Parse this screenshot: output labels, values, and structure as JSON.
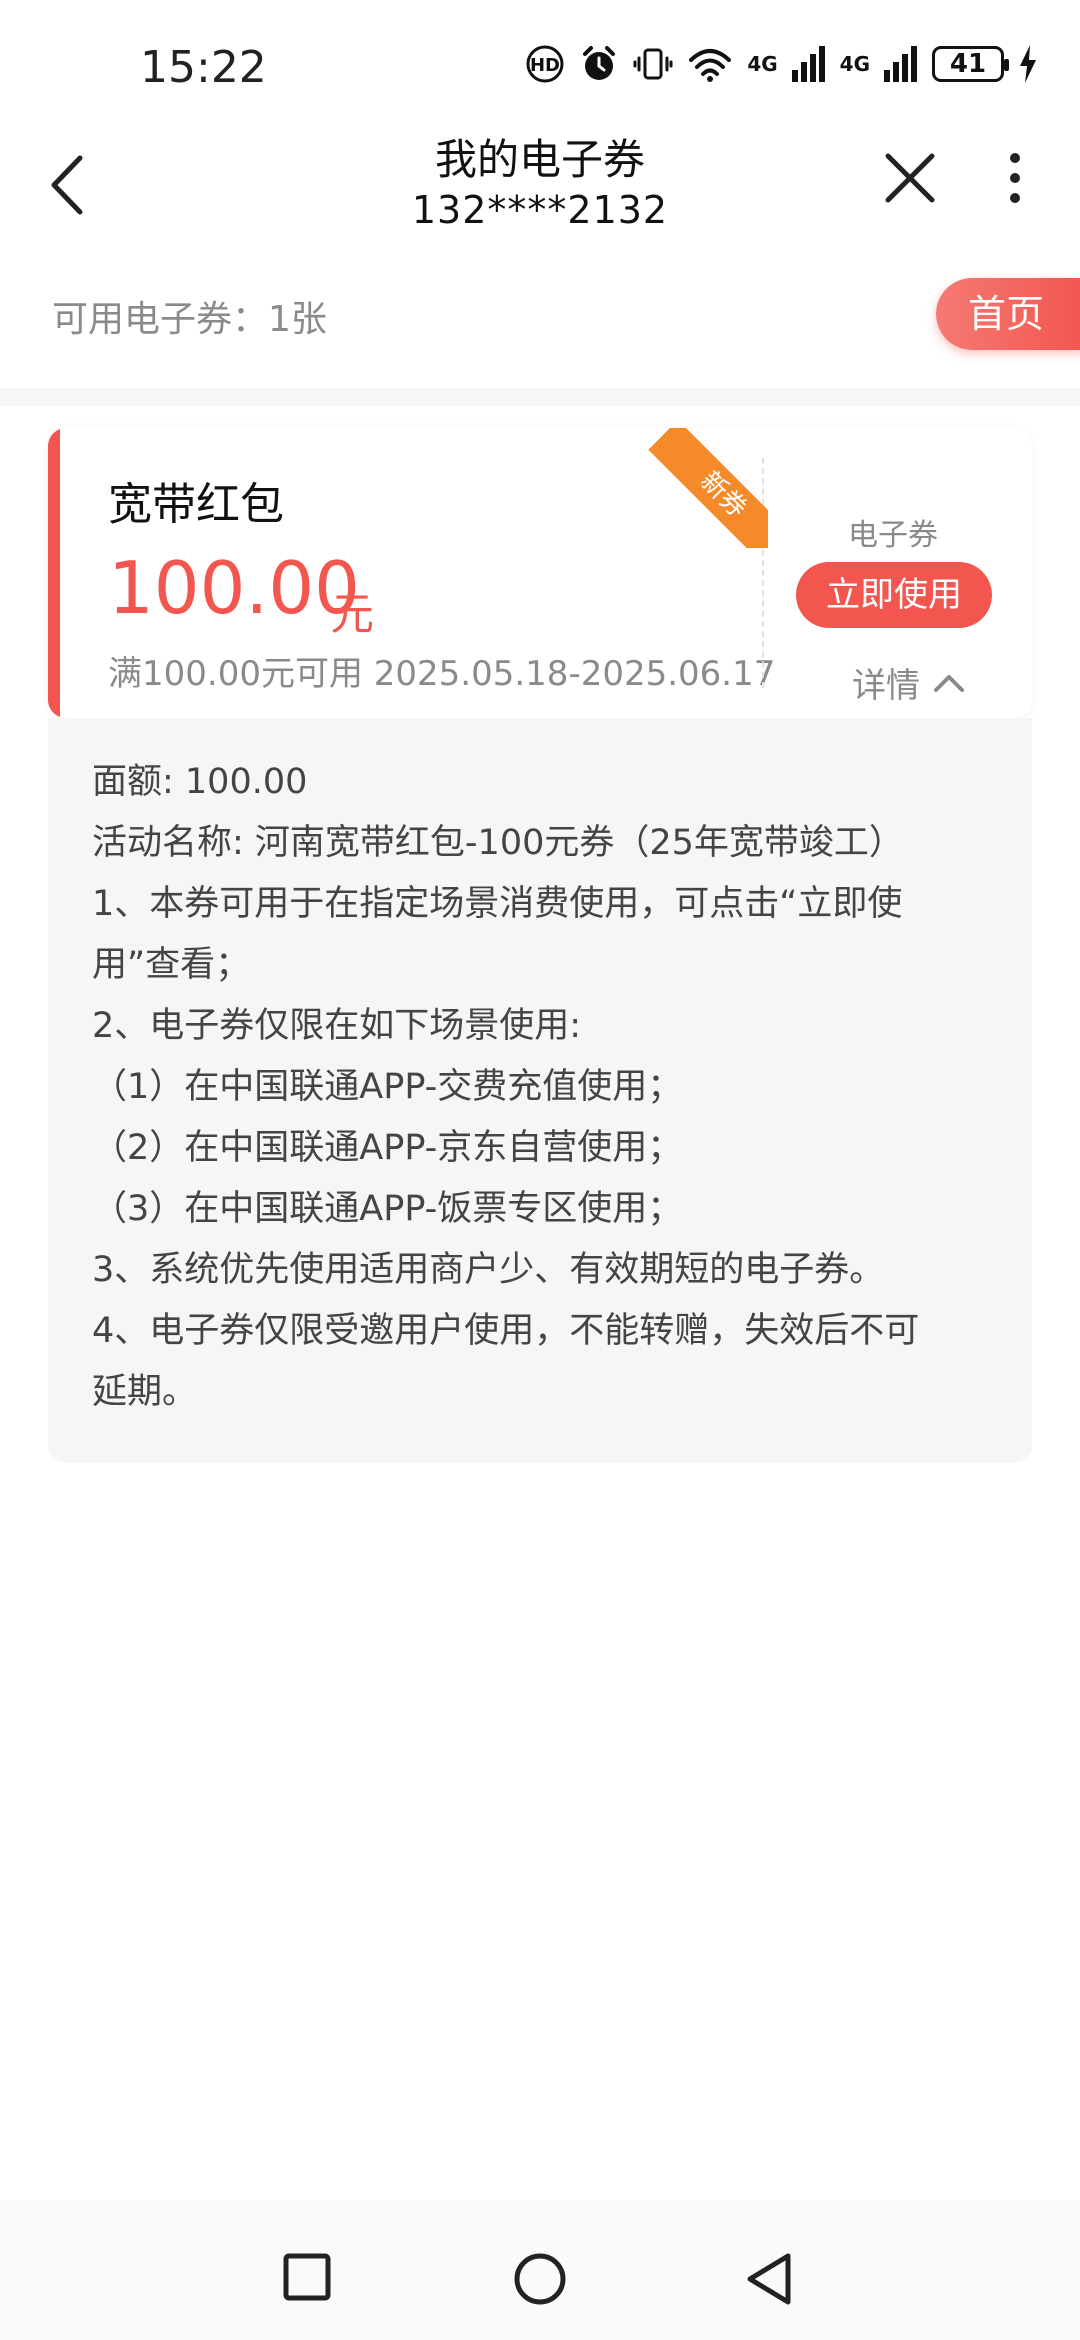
{
  "status_bar": {
    "time": "15:22",
    "net1": "4G",
    "net2": "4G",
    "battery": "41"
  },
  "header": {
    "title": "我的电子券",
    "subtitle": "132****2132"
  },
  "summary": {
    "available_text": "可用电子券：1张",
    "home_label": "首页"
  },
  "coupon": {
    "name": "宽带红包",
    "amount": "100.00",
    "unit": "元",
    "condition": "满100.00元可用 2025.05.18-2025.06.17",
    "ribbon": "新券",
    "type_label": "电子券",
    "use_label": "立即使用",
    "detail_label": "详情"
  },
  "details": [
    "面额: 100.00",
    "活动名称: 河南宽带红包-100元券（25年宽带竣工）",
    "1、本券可用于在指定场景消费使用，可点击“立即使",
    "用”查看；",
    "2、电子券仅限在如下场景使用:",
    "（1）在中国联通APP-交费充值使用；",
    "（2）在中国联通APP-京东自营使用；",
    "（3）在中国联通APP-饭票专区使用；",
    "3、系统优先使用适用商户少、有效期短的电子券。",
    "4、电子券仅限受邀用户使用，不能转赠，失效后不可",
    "延期。"
  ],
  "colors": {
    "accent": "#f2564f",
    "ribbon": "#f58a2a",
    "muted": "#8a8a8a"
  }
}
